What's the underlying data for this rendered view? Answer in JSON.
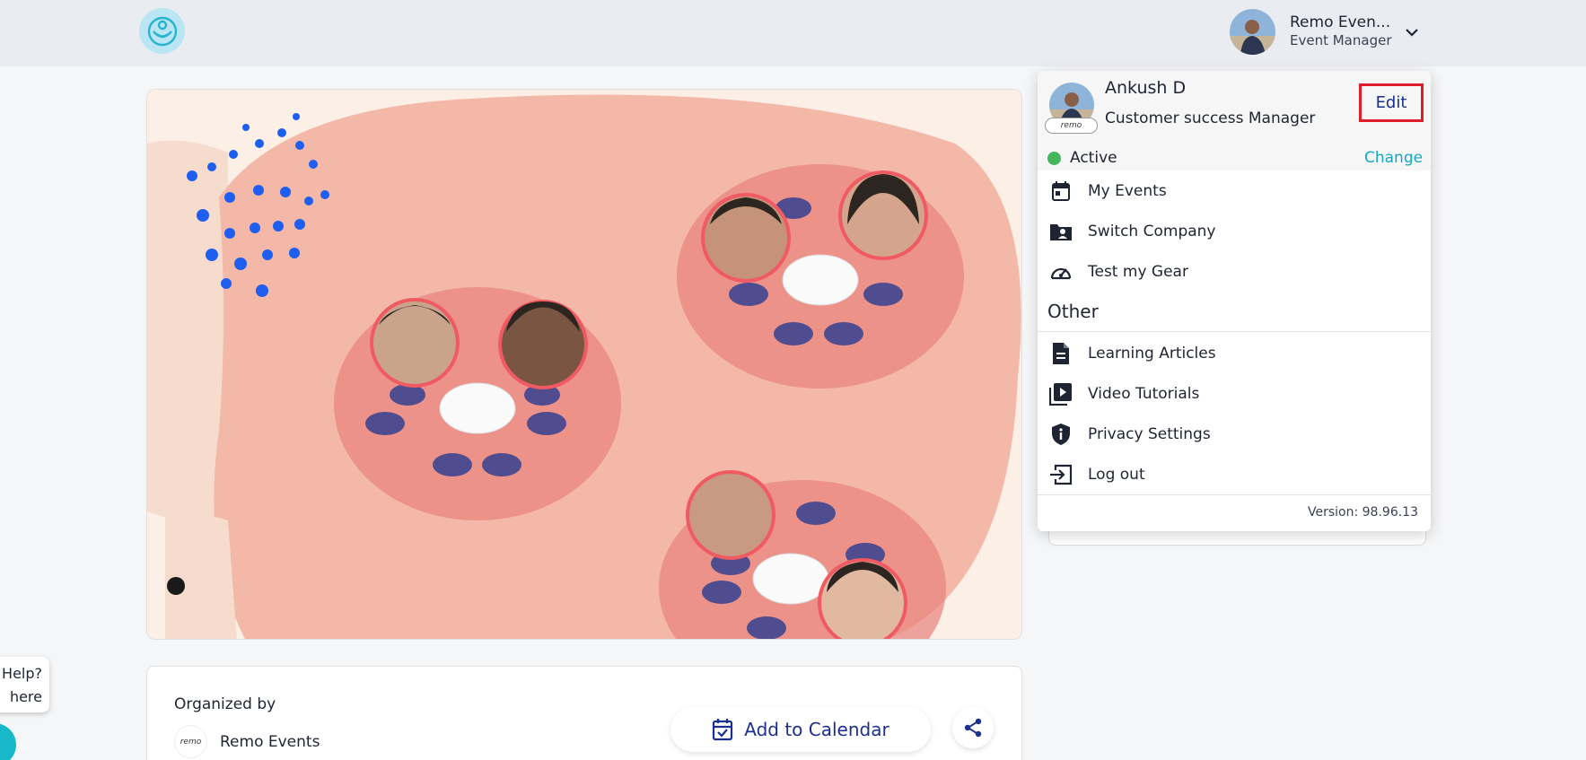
{
  "header": {
    "user_name": "Remo Even...",
    "user_role": "Event Manager"
  },
  "menu": {
    "name": "Ankush D",
    "title": "Customer success Manager",
    "edit_label": "Edit",
    "badge_text": "remo",
    "status": "Active",
    "change_label": "Change",
    "items": [
      {
        "label": "My Events",
        "icon": "calendar-icon"
      },
      {
        "label": "Switch Company",
        "icon": "folder-user-icon"
      },
      {
        "label": "Test my Gear",
        "icon": "speedometer-icon"
      }
    ],
    "other_label": "Other",
    "other_items": [
      {
        "label": "Learning Articles",
        "icon": "document-icon"
      },
      {
        "label": "Video Tutorials",
        "icon": "video-library-icon"
      },
      {
        "label": "Privacy Settings",
        "icon": "shield-info-icon"
      },
      {
        "label": "Log out",
        "icon": "logout-icon"
      }
    ],
    "version": "Version: 98.96.13"
  },
  "organizer": {
    "label": "Organized by",
    "name": "Remo Events",
    "logo_text": "remo",
    "calendar_label": "Add to Calendar"
  },
  "help": {
    "line1": "Help?",
    "line2": "here"
  },
  "colors": {
    "accent": "#1b2f8f",
    "teal": "#17a7c1",
    "active": "#43b75a",
    "highlight": "#e01e2a"
  }
}
